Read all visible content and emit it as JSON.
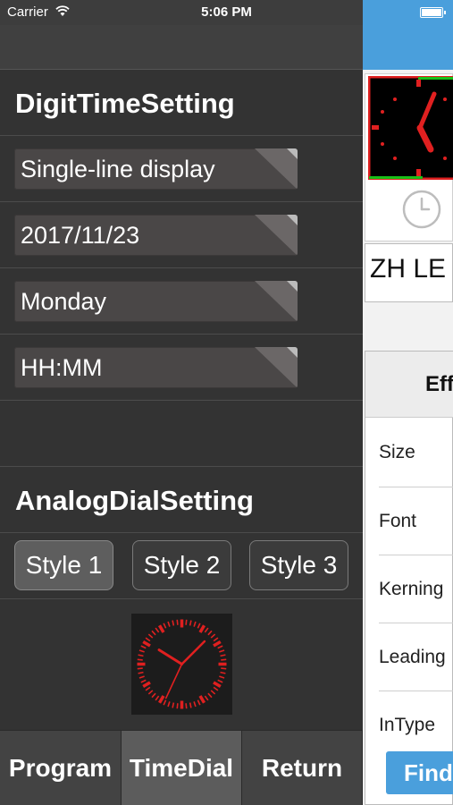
{
  "status_bar": {
    "carrier": "Carrier",
    "time": "5:06 PM"
  },
  "digit_section": {
    "title": "DigitTimeSetting",
    "dropdowns": [
      {
        "value": "Single-line display"
      },
      {
        "value": "2017/11/23"
      },
      {
        "value": "Monday"
      },
      {
        "value": "HH:MM"
      }
    ]
  },
  "analog_section": {
    "title": "AnalogDialSetting",
    "styles": [
      "Style 1",
      "Style 2",
      "Style 3"
    ],
    "selected_style": "Style 1"
  },
  "bottom_tabs": [
    {
      "label": "Program",
      "active": false
    },
    {
      "label": "TimeDial",
      "active": true
    },
    {
      "label": "Return",
      "active": false
    }
  ],
  "background_screen": {
    "text_field_value": "ZH LE",
    "table_header": "Eff",
    "properties": [
      "Size",
      "Font",
      "Kerning",
      "Leading",
      "InType"
    ],
    "find_button": "Find"
  },
  "colors": {
    "accent_blue": "#4a9fdc",
    "dial_red": "#e02020",
    "panel_dark": "#333333"
  }
}
